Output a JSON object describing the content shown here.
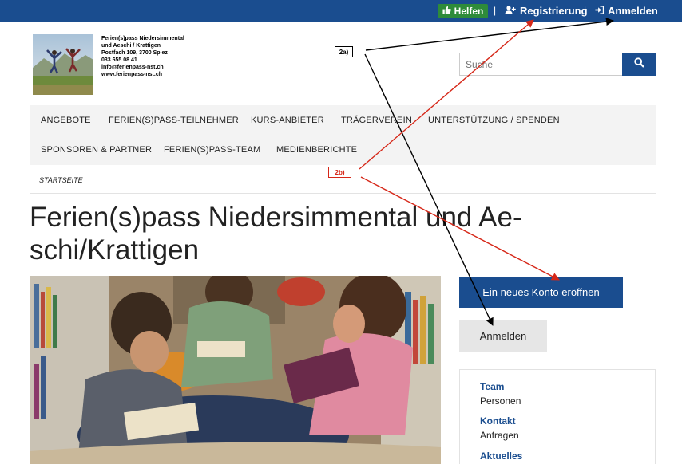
{
  "topbar": {
    "help_label": "Helfen",
    "separator": "|",
    "register_label": "Registrierung",
    "login_label": "Anmelden"
  },
  "logo": {
    "lines": [
      "Ferien(s)pass Niedersimmental",
      "und Aeschi / Krattigen",
      "Postfach 109, 3700 Spiez",
      "033 655 08 41",
      "info@ferienpass-nst.ch",
      "www.ferienpass-nst.ch"
    ]
  },
  "search": {
    "placeholder": "Suche"
  },
  "nav": {
    "row1": [
      "ANGEBOTE",
      "FERIEN(S)PASS-TEILNEHMER",
      "KURS-ANBIETER",
      "TRÄGERVEREIN",
      "UNTERSTÜTZUNG / SPENDEN"
    ],
    "row2": [
      "SPONSOREN & PARTNER",
      "FERIEN(S)PASS-TEAM",
      "MEDIENBERICHTE"
    ]
  },
  "breadcrumb": "STARTSEITE",
  "page_title_line1": "Ferien(s)pass Niedersimmental und Ae-",
  "page_title_line2": "schi/Krattigen",
  "buttons": {
    "new_account": "Ein neues Konto eröffnen",
    "login": "Anmelden"
  },
  "sidebar": {
    "items": [
      {
        "heading": "Team",
        "sub": "Personen"
      },
      {
        "heading": "Kontakt",
        "sub": "Anfragen"
      },
      {
        "heading": "Aktuelles",
        "sub": ""
      }
    ]
  },
  "annotations": {
    "a": "2a)",
    "b": "2b)"
  },
  "colors": {
    "primary_blue": "#1a4d8f",
    "help_green": "#2e8b3a",
    "annotation_red": "#d62718",
    "annotation_black": "#000000"
  },
  "icons": [
    "thumbs-up-icon",
    "user-plus-icon",
    "sign-in-icon",
    "search-icon"
  ]
}
